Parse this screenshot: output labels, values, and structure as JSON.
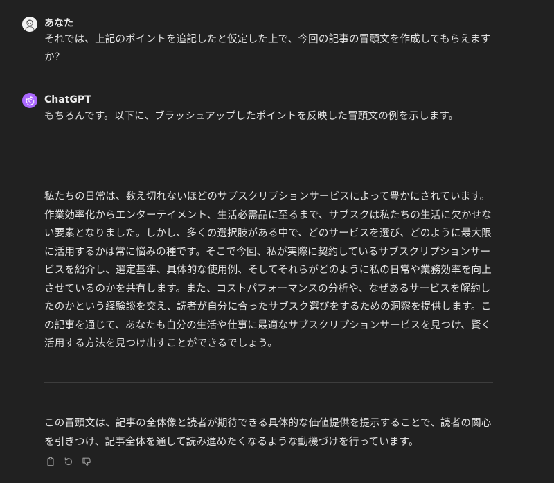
{
  "user_turn": {
    "author": "あなた",
    "avatar_icon": "user-avatar-icon",
    "message": "それでは、上記のポイントを追記したと仮定した上で、今回の記事の冒頭文を作成してもらえますか？"
  },
  "assistant_turn": {
    "author": "ChatGPT",
    "avatar_icon": "openai-logo-icon",
    "avatar_color": "#ab68ff",
    "intro": "もちろんです。以下に、ブラッシュアップしたポイントを反映した冒頭文の例を示します。",
    "draft": "私たちの日常は、数え切れないほどのサブスクリプションサービスによって豊かにされています。作業効率化からエンターテイメント、生活必需品に至るまで、サブスクは私たちの生活に欠かせない要素となりました。しかし、多くの選択肢がある中で、どのサービスを選び、どのように最大限に活用するかは常に悩みの種です。そこで今回、私が実際に契約しているサブスクリプションサービスを紹介し、選定基準、具体的な使用例、そしてそれらがどのように私の日常や業務効率を向上させているのかを共有します。また、コストパフォーマンスの分析や、なぜあるサービスを解約したのかという経験談を交え、読者が自分に合ったサブスク選びをするための洞察を提供します。この記事を通じて、あなたも自分の生活や仕事に最適なサブスクリプションサービスを見つけ、賢く活用する方法を見つけ出すことができるでしょう。",
    "closing": "この冒頭文は、記事の全体像と読者が期待できる具体的な価値提供を提示することで、読者の関心を引きつけ、記事全体を通して読み進めたくなるような動機づけを行っています。",
    "actions": [
      "copy-icon",
      "regenerate-icon",
      "thumbs-down-icon"
    ]
  },
  "colors": {
    "background": "#212121",
    "text": "#ececec",
    "divider": "#3d3d3d",
    "icon": "#9b9b9b"
  }
}
